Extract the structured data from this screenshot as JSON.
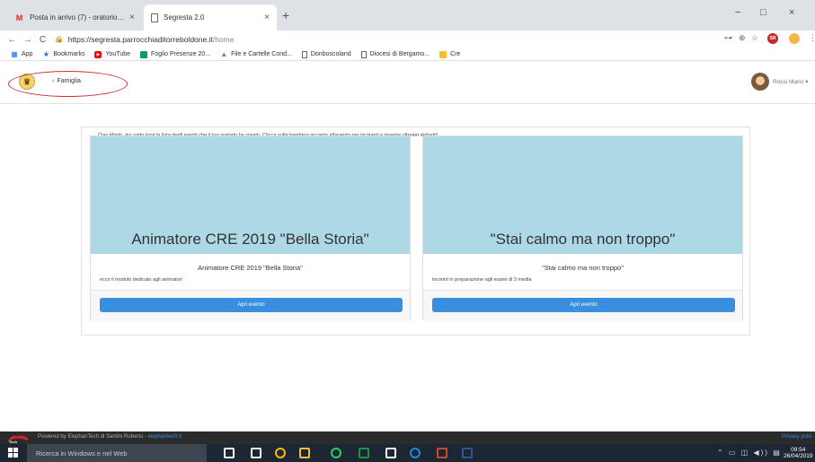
{
  "browser": {
    "tabs": [
      {
        "title": "Posta in arrivo (7) - oratoriotorre",
        "icon": "gmail-icon"
      },
      {
        "title": "Segresta 2.0",
        "icon": "page-icon"
      }
    ],
    "new_tab": "+",
    "window_controls": {
      "minimize": "−",
      "maximize": "□",
      "close": "×"
    },
    "nav": {
      "back": "←",
      "forward": "→",
      "reload": "C",
      "home": "⌂"
    },
    "url": {
      "host": "https://segresta.parrocchiaditorreboldone.it",
      "path": "/home"
    },
    "toolbar_icons": {
      "key": "⊶",
      "zoom": "⊕",
      "star": "☆",
      "ext": "SR",
      "menu": "⋮"
    },
    "bookmarks": [
      {
        "label": "App",
        "icon": "apps-grid-icon",
        "color": "#1a73e8"
      },
      {
        "label": "Bookmarks",
        "icon": "star-icon",
        "color": "#1a73e8"
      },
      {
        "label": "YouTube",
        "icon": "youtube-icon",
        "color": "#ff0000"
      },
      {
        "label": "Foglio Presenze 20...",
        "icon": "sheets-icon",
        "color": "#0f9d58"
      },
      {
        "label": "File e Cartelle Cond...",
        "icon": "drive-icon",
        "color": "#4285f4"
      },
      {
        "label": "Donboscoland",
        "icon": "page-icon",
        "color": "#666666"
      },
      {
        "label": "Diocesi di Bergamo...",
        "icon": "page-icon",
        "color": "#666666"
      },
      {
        "label": "Cre",
        "icon": "folder-icon",
        "color": "#f6c026"
      }
    ]
  },
  "app": {
    "nav_item": "Famiglia",
    "nav_item_icon": "user-icon",
    "user_name": "Rossi Mario",
    "caret": "▾"
  },
  "content": {
    "intro": "Ciao Mario, qui sotto trovi la lista degli eventi che il tuo oratorio ha creato. Clicca sulla bandiera accanto all'evento per iscriverti e inserire ulteriori dettagli!",
    "events": [
      {
        "image_title": "Animatore CRE 2019 \"Bella Storia\"",
        "title": "Animatore CRE 2019 \"Bella Storia\"",
        "description": "ecco il modulo dedicato agli animatori",
        "button": "Apri evento"
      },
      {
        "image_title": "\"Stai calmo ma non troppo\"",
        "title": "\"Stai calmo ma non troppo\"",
        "description": "incontri in preparazione agli esami di 3 media",
        "button": "Apri evento"
      }
    ]
  },
  "footer": {
    "text": "Powered by ElephanTech di Santini Roberto - ",
    "link": "elephantech.it",
    "privacy": "Privacy polic"
  },
  "taskbar": {
    "search_placeholder": "Ricerca in Windows e nel Web",
    "time": "09:54",
    "date": "26/04/2019",
    "apps": [
      {
        "icon": "task-view-icon",
        "color": "#ffffff"
      },
      {
        "icon": "mail-app-icon",
        "color": "#ffffff"
      },
      {
        "icon": "chrome-icon",
        "color": "#fbbc05"
      },
      {
        "icon": "file-explorer-icon",
        "color": "#f0c040"
      },
      {
        "icon": "whatsapp-icon",
        "color": "#25d366"
      },
      {
        "icon": "project-icon",
        "color": "#1f8f4a"
      },
      {
        "icon": "store-icon",
        "color": "#ffffff"
      },
      {
        "icon": "edge-icon",
        "color": "#1e88e5"
      },
      {
        "icon": "powerpoint-icon",
        "color": "#d24726"
      },
      {
        "icon": "word-icon",
        "color": "#2b579a"
      }
    ]
  }
}
